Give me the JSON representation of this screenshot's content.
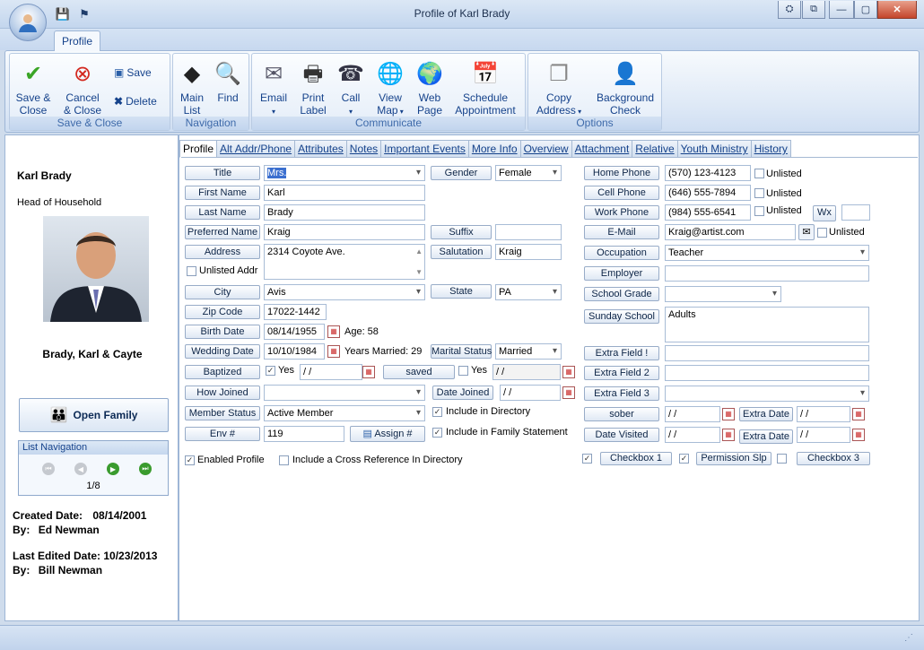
{
  "window": {
    "title": "Profile of Karl Brady",
    "minimize": "—",
    "maximize": "▢",
    "close": "✕",
    "restore": "⧉",
    "help": "⛭"
  },
  "ribbon": {
    "tab": "Profile",
    "groups": {
      "save_close": "Save & Close",
      "navigation": "Navigation",
      "communicate": "Communicate",
      "options": "Options"
    },
    "buttons": {
      "save_close": [
        "Save &",
        "Close"
      ],
      "cancel_close": [
        "Cancel",
        "& Close"
      ],
      "save": "Save",
      "delete": "Delete",
      "main_list": [
        "Main",
        "List"
      ],
      "find": "Find",
      "email": "Email",
      "print_label": [
        "Print",
        "Label"
      ],
      "call": "Call",
      "view_map": [
        "View",
        "Map"
      ],
      "web_page": [
        "Web",
        "Page"
      ],
      "schedule": [
        "Schedule",
        "Appointment"
      ],
      "copy_address": [
        "Copy",
        "Address"
      ],
      "background_check": [
        "Background",
        "Check"
      ]
    }
  },
  "left": {
    "name": "Karl Brady",
    "role": "Head of Household",
    "family_name": "Brady, Karl & Cayte",
    "open_family": "Open Family",
    "list_nav_title": "List Navigation",
    "list_pos": "1/8",
    "created_label": "Created Date:",
    "created_date": "08/14/2001",
    "by_label": "By:",
    "created_by": "Ed Newman",
    "edited_label": "Last Edited Date:",
    "edited_date": "10/23/2013",
    "edited_by": "Bill Newman"
  },
  "tabs": [
    "Profile",
    "Alt Addr/Phone",
    "Attributes",
    "Notes",
    "Important Events",
    "More Info",
    "Overview",
    "Attachment",
    "Relative",
    "Youth Ministry",
    "History"
  ],
  "form": {
    "title_lbl": "Title",
    "title_val": "Mrs.",
    "first_lbl": "First Name",
    "first_val": "Karl",
    "last_lbl": "Last Name",
    "last_val": "Brady",
    "pref_lbl": "Preferred Name",
    "pref_val": "Kraig",
    "addr_lbl": "Address",
    "addr_val": "2314 Coyote Ave.",
    "unlisted_addr": "Unlisted Addr",
    "city_lbl": "City",
    "city_val": "Avis",
    "zip_lbl": "Zip Code",
    "zip_val": "17022-1442",
    "birth_lbl": "Birth Date",
    "birth_val": "08/14/1955",
    "age": "Age: 58",
    "wed_lbl": "Wedding Date",
    "wed_val": "10/10/1984",
    "years_married": "Years Married: 29",
    "bapt_lbl": "Baptized",
    "bapt_yes": "Yes",
    "bapt_date": " /  /",
    "saved_lbl": "saved",
    "saved_yes": "Yes",
    "saved_date": " /  /",
    "joined_lbl": "How Joined",
    "joined_val": "",
    "date_joined_lbl": "Date Joined",
    "date_joined_val": " /  /",
    "status_lbl": "Member Status",
    "status_val": "Active Member",
    "incl_dir": "Include in Directory",
    "env_lbl": "Env #",
    "env_val": "119",
    "assign": "Assign #",
    "incl_stmt": "Include in Family Statement",
    "gender_lbl": "Gender",
    "gender_val": "Female",
    "suffix_lbl": "Suffix",
    "suffix_val": "",
    "salut_lbl": "Salutation",
    "salut_val": "Kraig",
    "state_lbl": "State",
    "state_val": "PA",
    "marital_lbl": "Marital Status",
    "marital_val": "Married",
    "home_lbl": "Home Phone",
    "home_val": "(570) 123-4123",
    "cell_lbl": "Cell Phone",
    "cell_val": "(646) 555-7894",
    "work_lbl": "Work Phone",
    "work_val": "(984) 555-6541",
    "wx_lbl": "Wx",
    "wx_val": "",
    "unlisted": "Unlisted",
    "email_lbl": "E-Mail",
    "email_val": "Kraig@artist.com",
    "occ_lbl": "Occupation",
    "occ_val": "Teacher",
    "emp_lbl": "Employer",
    "emp_val": "",
    "grade_lbl": "School Grade",
    "grade_val": "",
    "sunday_lbl": "Sunday School",
    "sunday_val": "Adults",
    "ef1_lbl": "Extra Field !",
    "ef2_lbl": "Extra Field 2",
    "ef3_lbl": "Extra Field 3",
    "sober_lbl": "sober",
    "sober_val": " /  /",
    "extra_date_lbl": "Extra Date",
    "extra_date_val": " /  /",
    "visited_lbl": "Date Visited",
    "visited_val": " /  /",
    "extra_date2_val": " /  /",
    "enabled_profile": "Enabled Profile",
    "cross_ref": "Include a Cross Reference In Directory",
    "checkbox1": "Checkbox 1",
    "permission": "Permission Slp",
    "checkbox3": "Checkbox 3"
  }
}
